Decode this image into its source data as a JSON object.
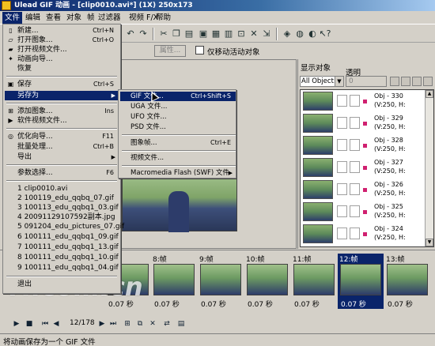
{
  "window": {
    "title": "Ulead GIF 动画 - [clip0010.avi*] (1X) 250x173"
  },
  "menubar": {
    "items": [
      {
        "label": "文件",
        "active": true
      },
      {
        "label": "编辑"
      },
      {
        "label": "查看"
      },
      {
        "label": "对象"
      },
      {
        "label": "帧"
      },
      {
        "label": "过滤器"
      },
      {
        "label": "视频 F/X"
      },
      {
        "label": "帮助"
      }
    ]
  },
  "toolbar2": {
    "attr_label": "属性...",
    "checkbox_label": "仅移动活动对象"
  },
  "file_menu": {
    "items": [
      {
        "label": "新建...",
        "shortcut": "Ctrl+N",
        "icon": "new-file-icon"
      },
      {
        "label": "打开图象...",
        "shortcut": "Ctrl+O",
        "icon": "open-image-icon"
      },
      {
        "label": "打开视频文件...",
        "icon": "open-video-icon"
      },
      {
        "label": "动画向导...",
        "icon": "wizard-icon"
      },
      {
        "label": "恢复"
      },
      {
        "label": "保存",
        "shortcut": "Ctrl+S",
        "icon": "save-icon"
      },
      {
        "label": "另存为",
        "submenu": true,
        "highlight": true
      },
      {
        "label": "添加图象...",
        "shortcut": "Ins",
        "icon": "add-image-icon"
      },
      {
        "label": "软件视频文件...",
        "icon": "video-file-icon"
      },
      {
        "label": "优化向导...",
        "shortcut": "F11",
        "icon": "optimize-icon"
      },
      {
        "label": "批量处理...",
        "shortcut": "Ctrl+B"
      },
      {
        "label": "导出",
        "submenu": true
      },
      {
        "label": "参数选择...",
        "shortcut": "F6"
      },
      {
        "label": "1 clip0010.avi"
      },
      {
        "label": "2 100119_edu_qqbq_07.gif"
      },
      {
        "label": "3 100113_edu_qqbq1_03.gif"
      },
      {
        "label": "4 20091129107592副本.jpg"
      },
      {
        "label": "5 091204_edu_pictures_07.gif"
      },
      {
        "label": "6 100111_edu_qqbq1_09.gif"
      },
      {
        "label": "7 100111_edu_qqbq1_13.gif"
      },
      {
        "label": "8 100111_edu_qqbq1_10.gif"
      },
      {
        "label": "9 100111_edu_qqbq1_04.gif"
      },
      {
        "label": "退出"
      }
    ]
  },
  "saveas_submenu": {
    "items": [
      {
        "label": "GIF 文件...",
        "shortcut": "Ctrl+Shift+S",
        "highlight": true
      },
      {
        "label": "UGA 文件..."
      },
      {
        "label": "UFO 文件..."
      },
      {
        "label": "PSD 文件..."
      },
      {
        "label": "图象帧...",
        "shortcut": "Ctrl+E"
      },
      {
        "label": "视频文件..."
      },
      {
        "label": "Macromedia Flash (SWF) 文件",
        "submenu": true
      }
    ]
  },
  "objects_panel": {
    "title": "显示对象",
    "transparency_label": "透明",
    "filter_value": "All Object:",
    "transparency_value": "0",
    "rows": [
      {
        "name": "Obj - 330",
        "pos": "(V:250, H:"
      },
      {
        "name": "Obj - 329",
        "pos": "(V:250, H:"
      },
      {
        "name": "Obj - 328",
        "pos": "(V:250, H:"
      },
      {
        "name": "Obj - 327",
        "pos": "(V:250, H:"
      },
      {
        "name": "Obj - 326",
        "pos": "(V:250, H:"
      },
      {
        "name": "Obj - 325",
        "pos": "(V:250, H:"
      },
      {
        "name": "Obj - 324",
        "pos": "(V:250, H:"
      }
    ]
  },
  "frames": {
    "items": [
      {
        "title": "",
        "delay": "0.07 秒"
      },
      {
        "title": "8:帧",
        "delay": "0.07 秒"
      },
      {
        "title": "9:帧",
        "delay": "0.07 秒"
      },
      {
        "title": "10:帧",
        "delay": "0.07 秒"
      },
      {
        "title": "11:帧",
        "delay": "0.07 秒"
      },
      {
        "title": "12:帧",
        "delay": "0.07 秒",
        "active": true
      },
      {
        "title": "13:帧",
        "delay": "0.07 秒"
      }
    ]
  },
  "playbar": {
    "frame_counter": "12/178"
  },
  "status": {
    "text": "将动画保存为一个 GIF 文件"
  },
  "watermark": {
    "text": "IT.com.cn"
  },
  "colors": {
    "highlight": "#0a246a",
    "face": "#d4d0c8"
  }
}
